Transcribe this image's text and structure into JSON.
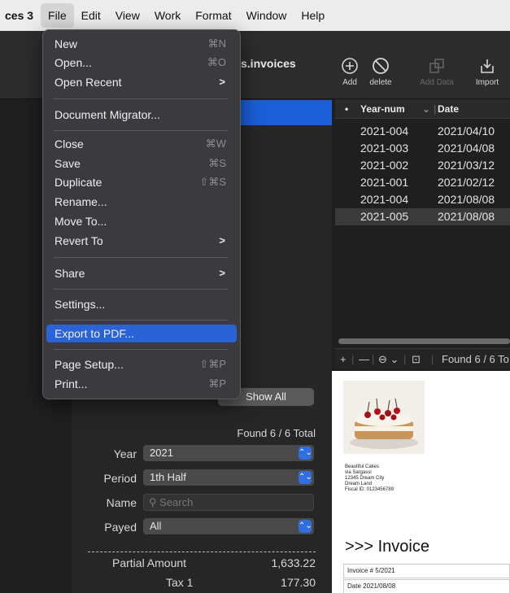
{
  "menubar": {
    "app_fragment": "ces 3",
    "items": [
      "File",
      "Edit",
      "View",
      "Work",
      "Format",
      "Window",
      "Help"
    ]
  },
  "window": {
    "title_fragment": "s.invoices"
  },
  "toolbar": {
    "add_label": "Add",
    "delete_label": "delete",
    "add_data_label": "Add Data",
    "import_label": "Import"
  },
  "file_menu": {
    "new": {
      "label": "New",
      "shortcut": "⌘N"
    },
    "open": {
      "label": "Open...",
      "shortcut": "⌘O"
    },
    "open_recent": {
      "label": "Open Recent"
    },
    "document_migrator": {
      "label": "Document Migrator..."
    },
    "close": {
      "label": "Close",
      "shortcut": "⌘W"
    },
    "save": {
      "label": "Save",
      "shortcut": "⌘S"
    },
    "duplicate": {
      "label": "Duplicate",
      "shortcut": "⇧⌘S"
    },
    "rename": {
      "label": "Rename..."
    },
    "move_to": {
      "label": "Move To..."
    },
    "revert_to": {
      "label": "Revert To"
    },
    "share": {
      "label": "Share"
    },
    "settings": {
      "label": "Settings..."
    },
    "export_pdf": {
      "label": "Export to PDF..."
    },
    "page_setup": {
      "label": "Page Setup...",
      "shortcut": "⇧⌘P"
    },
    "print": {
      "label": "Print...",
      "shortcut": "⌘P"
    }
  },
  "table": {
    "columns": {
      "year_num": "Year-num",
      "date": "Date"
    },
    "rows": [
      {
        "year_num": "2021-004",
        "date": "2021/04/10"
      },
      {
        "year_num": "2021-003",
        "date": "2021/04/08"
      },
      {
        "year_num": "2021-002",
        "date": "2021/03/12"
      },
      {
        "year_num": "2021-001",
        "date": "2021/02/12"
      },
      {
        "year_num": "2021-004",
        "date": "2021/08/08"
      },
      {
        "year_num": "2021-005",
        "date": "2021/08/08"
      }
    ],
    "found_text": "Found 6 / 6 To"
  },
  "sidebar": {
    "show_all_label": "Show All",
    "found_text": "Found 6 / 6 Total",
    "filters": {
      "year": {
        "label": "Year",
        "value": "2021"
      },
      "period": {
        "label": "Period",
        "value": "1th Half"
      },
      "name": {
        "label": "Name",
        "placeholder": "Search"
      },
      "payed": {
        "label": "Payed",
        "value": "All"
      }
    },
    "summary": {
      "partial_label": "Partial Amount",
      "partial_value": "1,633.22",
      "tax_label": "Tax 1",
      "tax_value": "177.30"
    }
  },
  "invoice": {
    "addr_lines": [
      "Beautiful Cakes",
      "via Sargassi",
      "12345 Dream City",
      "Dream Land",
      "Fiscal ID: 0123456789"
    ],
    "title": ">>> Invoice",
    "number": "Invoice # 5/2021",
    "date": "Date 2021/08/08"
  },
  "colors": {
    "accent": "#2a63d6",
    "menu_bg": "#3b3b3e",
    "dark_bg": "#1f1f1f"
  }
}
